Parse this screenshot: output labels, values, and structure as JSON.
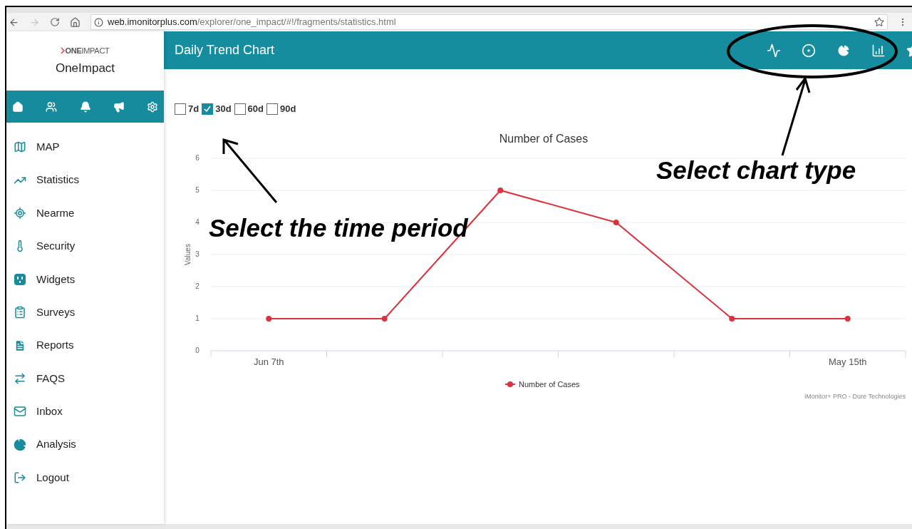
{
  "browser": {
    "url": "**web.imonitorplus.com**/explorer/one_impact/#!/fragments/statistics.html",
    "forward_disabled": true
  },
  "sidebar": {
    "logo_text": "**ONE**IMPACT",
    "app_name": "OneImpact",
    "items": [
      {
        "label": "MAP"
      },
      {
        "label": "Statistics"
      },
      {
        "label": "Nearme"
      },
      {
        "label": "Security"
      },
      {
        "label": "Widgets"
      },
      {
        "label": "Surveys"
      },
      {
        "label": "Reports"
      },
      {
        "label": "FAQS"
      },
      {
        "label": "Inbox"
      },
      {
        "label": "Analysis"
      },
      {
        "label": "Logout"
      }
    ]
  },
  "header": {
    "title": "Daily Trend Chart"
  },
  "periods": [
    {
      "label": "7d",
      "checked": false
    },
    {
      "label": "30d",
      "checked": true
    },
    {
      "label": "60d",
      "checked": false
    },
    {
      "label": "90d",
      "checked": false
    }
  ],
  "chart": {
    "chart_data": {
      "type": "line",
      "title": "Number of Cases",
      "ylabel": "Values",
      "categories": [
        "Jun 7th",
        null,
        null,
        null,
        null,
        "May 15th"
      ],
      "grid": true,
      "series": [
        {
          "name": "Number of Cases",
          "color": "#d9343d",
          "marker": true,
          "values": [
            1,
            1,
            5,
            4,
            1,
            1
          ]
        }
      ],
      "ylim": [
        0,
        6
      ],
      "yticks": [
        0,
        1,
        2,
        3,
        4,
        5,
        6
      ]
    },
    "credits": "iMonitor+ PRO - Dure Technologies"
  },
  "annotations": [
    {
      "text": "Select the time period"
    },
    {
      "text": "Select chart type"
    }
  ]
}
